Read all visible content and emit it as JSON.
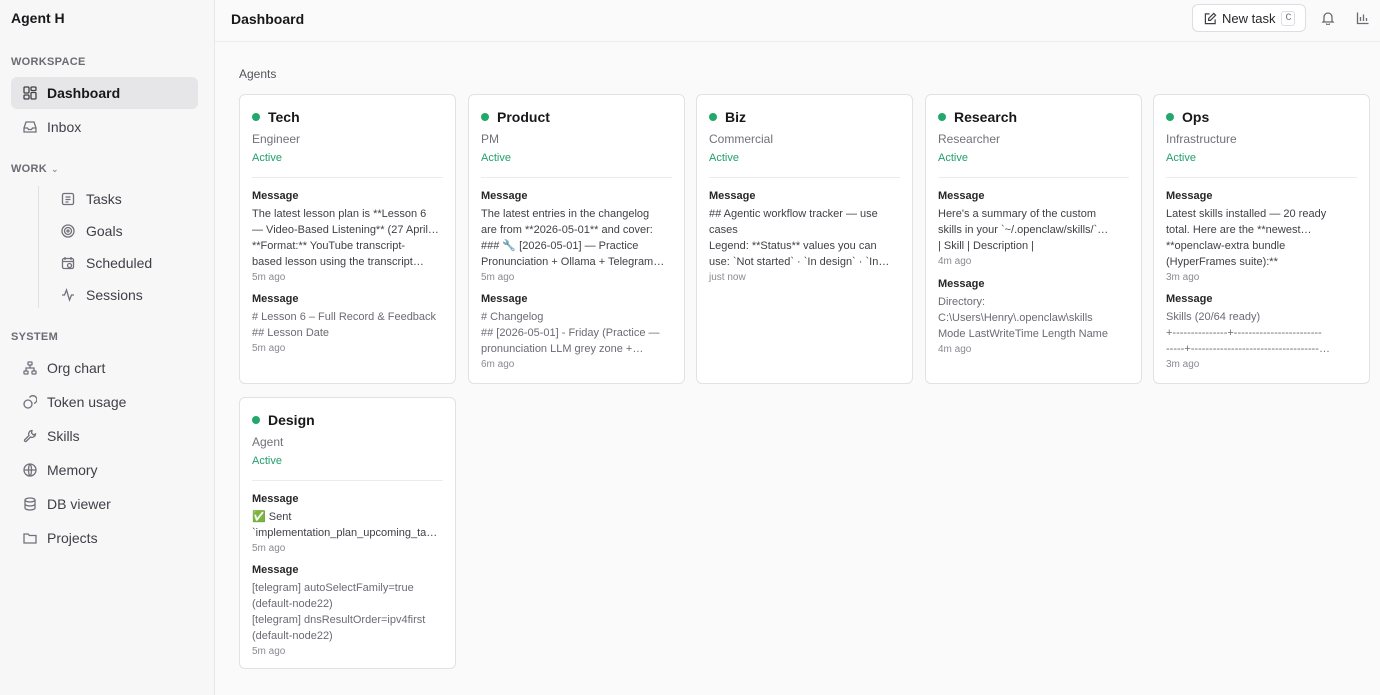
{
  "app": {
    "title": "Agent H"
  },
  "sidebar": {
    "workspace_label": "WORKSPACE",
    "workspace": [
      {
        "label": "Dashboard",
        "icon": "dashboard-grid-icon",
        "active": true
      },
      {
        "label": "Inbox",
        "icon": "inbox-icon"
      }
    ],
    "work_label": "WORK",
    "work": [
      {
        "label": "Tasks",
        "icon": "tasks-icon"
      },
      {
        "label": "Goals",
        "icon": "target-icon"
      },
      {
        "label": "Scheduled",
        "icon": "calendar-clock-icon"
      },
      {
        "label": "Sessions",
        "icon": "activity-icon"
      }
    ],
    "system_label": "SYSTEM",
    "system": [
      {
        "label": "Org chart",
        "icon": "org-chart-icon"
      },
      {
        "label": "Token usage",
        "icon": "token-icon"
      },
      {
        "label": "Skills",
        "icon": "wrench-icon"
      },
      {
        "label": "Memory",
        "icon": "brain-icon"
      },
      {
        "label": "DB viewer",
        "icon": "database-icon"
      },
      {
        "label": "Projects",
        "icon": "folder-icon"
      }
    ]
  },
  "header": {
    "title": "Dashboard",
    "new_task_label": "New task",
    "new_task_shortcut": "C"
  },
  "main": {
    "section_label": "Agents",
    "status_color": "#22a06b",
    "agents": [
      {
        "name": "Tech",
        "role": "Engineer",
        "status": "Active",
        "messages": [
          {
            "label": "Message",
            "lines": [
              "The latest lesson plan is **Lesson 6",
              "— Video-Based Listening** (27 April…",
              "**Format:** YouTube transcript-",
              "based lesson using the transcript…"
            ],
            "time": "5m ago"
          },
          {
            "label": "Message",
            "lines": [
              "# Lesson 6 – Full Record & Feedback",
              "## Lesson Date"
            ],
            "time": "5m ago"
          }
        ]
      },
      {
        "name": "Product",
        "role": "PM",
        "status": "Active",
        "messages": [
          {
            "label": "Message",
            "lines": [
              "The latest entries in the changelog",
              "are from **2026-05-01** and cover:",
              "### 🔧 [2026-05-01] — Practice",
              "Pronunciation + Ollama + Telegram…"
            ],
            "time": "5m ago"
          },
          {
            "label": "Message",
            "lines": [
              "# Changelog",
              "## [2026-05-01] - Friday (Practice —",
              "pronunciation LLM grey zone +…"
            ],
            "time": "6m ago"
          }
        ]
      },
      {
        "name": "Biz",
        "role": "Commercial",
        "status": "Active",
        "messages": [
          {
            "label": "Message",
            "lines": [
              "## Agentic workflow tracker — use",
              "cases",
              "Legend: **Status** values you can",
              "use: `Not started` · `In design` · `In…"
            ],
            "time": "just now"
          }
        ]
      },
      {
        "name": "Research",
        "role": "Researcher",
        "status": "Active",
        "messages": [
          {
            "label": "Message",
            "lines": [
              "Here's a summary of the custom",
              "skills in your `~/.openclaw/skills/`…",
              "| Skill | Description |"
            ],
            "time": "4m ago"
          },
          {
            "label": "Message",
            "lines": [
              "Directory:",
              "C:\\Users\\Henry\\.openclaw\\skills",
              "Mode LastWriteTime Length Name"
            ],
            "time": "4m ago"
          }
        ]
      },
      {
        "name": "Ops",
        "role": "Infrastructure",
        "status": "Active",
        "messages": [
          {
            "label": "Message",
            "lines": [
              "Latest skills installed — 20 ready",
              "total. Here are the **newest…",
              "**openclaw-extra bundle",
              "(HyperFrames suite):**"
            ],
            "time": "3m ago"
          },
          {
            "label": "Message",
            "lines": [
              "Skills (20/64 ready)",
              "+---------------+------------------------",
              "-----+-----------------------------------…"
            ],
            "time": "3m ago"
          }
        ]
      },
      {
        "name": "Design",
        "role": "Agent",
        "status": "Active",
        "messages": [
          {
            "label": "Message",
            "lines": [
              "✅ Sent",
              "`implementation_plan_upcoming_ta…"
            ],
            "time": "5m ago"
          },
          {
            "label": "Message",
            "lines": [
              "[telegram] autoSelectFamily=true",
              "(default-node22)",
              "[telegram] dnsResultOrder=ipv4first",
              "(default-node22)"
            ],
            "time": "5m ago"
          }
        ]
      }
    ]
  }
}
